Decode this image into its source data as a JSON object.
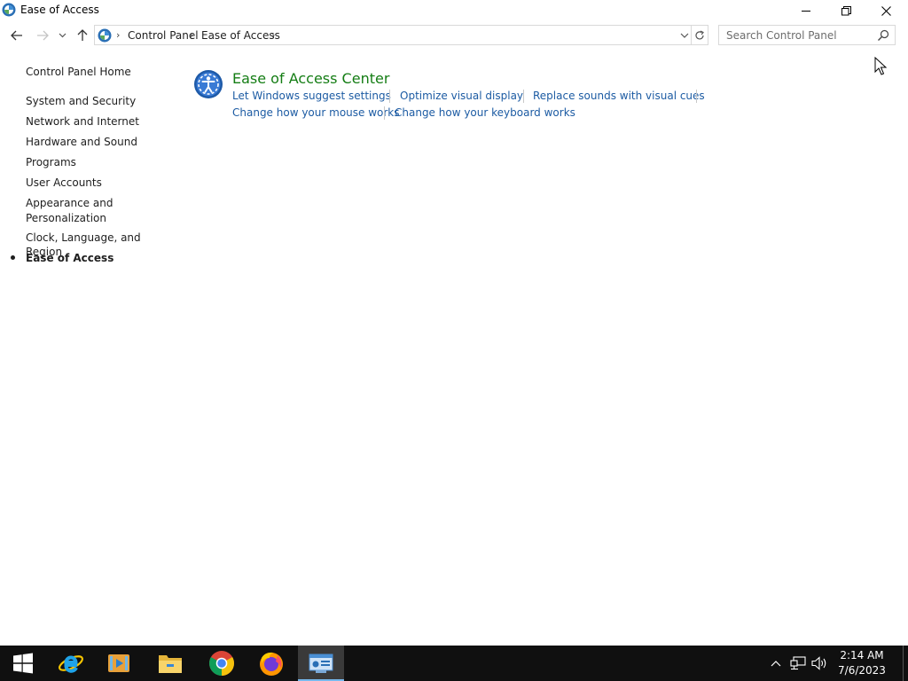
{
  "window": {
    "title": "Ease of Access",
    "icon": "control-panel-icon",
    "controls": [
      "minimize-icon",
      "restore-icon",
      "close-icon"
    ]
  },
  "address": {
    "breadcrumb": [
      "Control Panel",
      "Ease of Access"
    ],
    "refresh_icon": "refresh-icon"
  },
  "search": {
    "placeholder": "Search Control Panel"
  },
  "sidebar": {
    "home": "Control Panel Home",
    "items": [
      {
        "label": "System and Security"
      },
      {
        "label": "Network and Internet"
      },
      {
        "label": "Hardware and Sound"
      },
      {
        "label": "Programs"
      },
      {
        "label": "User Accounts"
      },
      {
        "label": "Appearance and Personalization"
      },
      {
        "label": "Clock, Language, and Region"
      },
      {
        "label": "Ease of Access",
        "current": true
      }
    ]
  },
  "main": {
    "category": {
      "title": "Ease of Access Center",
      "icon": "ease-of-access-icon",
      "tasks": [
        "Let Windows suggest settings",
        "Optimize visual display",
        "Replace sounds with visual cues",
        "Change how your mouse works",
        "Change how your keyboard works"
      ]
    }
  },
  "taskbar": {
    "items": [
      "start-icon",
      "internet-explorer-icon",
      "media-player-icon",
      "file-explorer-icon",
      "chrome-icon",
      "firefox-icon",
      "control-panel-icon"
    ],
    "active": "control-panel-icon",
    "tray": [
      "chevron-up-icon",
      "network-icon",
      "volume-icon"
    ],
    "time": "2:14 AM",
    "date": "7/6/2023"
  },
  "colors": {
    "accent_green": "#147d14",
    "link_blue": "#1c5ba3",
    "taskbar": "#101010"
  }
}
